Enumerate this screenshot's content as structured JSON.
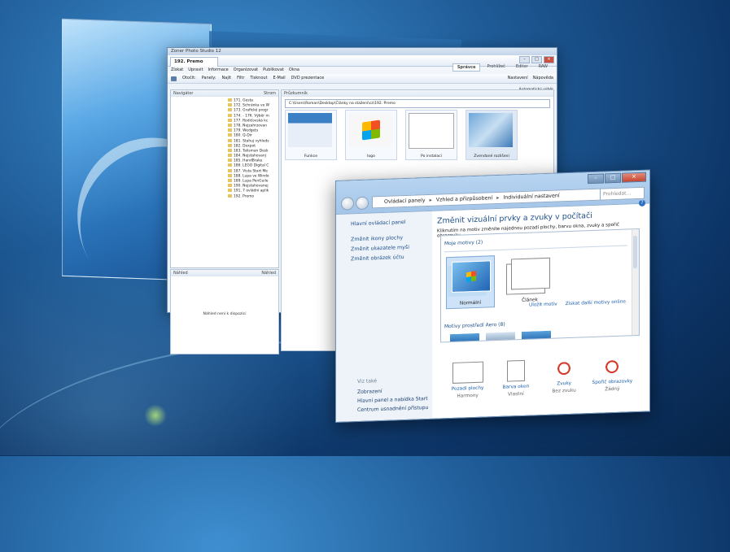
{
  "zoner": {
    "app_title": "Zoner Photo Studio 12",
    "tab": "192. Premo",
    "view_tabs": [
      "Správce",
      "Prohlížeč",
      "Editor",
      "RAW"
    ],
    "active_view": "Správce",
    "menu": [
      "Získat",
      "Upravit",
      "Informace",
      "Organizovat",
      "Publikovat",
      "Okna"
    ],
    "toolbar": [
      "Otočit:",
      "Panely:",
      "Najít",
      "Filtr",
      "Tisknout",
      "E-Mail",
      "DVD prezentace"
    ],
    "toolbar_right": [
      "Nastavení",
      "Nápověda"
    ],
    "toolbar_right2": "Automatický výběr",
    "navigator_title": "Navigátor",
    "navigator_right": "Strom",
    "explorer_title": "Průzkumník",
    "address": "C:\\Users\\Roman\\Desktop\\Články na stažení\\cz\\192. Premo",
    "tree": [
      "171. Gesta",
      "172. Schránka ve W",
      "173. Grafické progr",
      "174. - 176. Výběr m",
      "177. Rodičovská kc",
      "178. Nejzahrzovan",
      "179. Wedgets",
      "180. Q-Dir",
      "181. Stahuj vyhleds",
      "182. Dexpot",
      "183. Talisman Desk",
      "184. Nejstahovanj",
      "185. HandBrake",
      "186. LEGO Digital C",
      "187. Vista Start Me",
      "188. Lupa ve Windo",
      "189. Lupa PenGuile",
      "190. Nejstahovanej",
      "191. 7 ovládní aplik",
      "192. Premo"
    ],
    "preview_title": "Náhled",
    "preview_right": "Náhled",
    "preview_message": "Náhled není k dispozici",
    "thumbnails": [
      "Funkce",
      "logo",
      "Po instalaci",
      "Zvendané rozlišení"
    ]
  },
  "control_panel": {
    "breadcrumb": [
      "Ovládací panely",
      "Vzhled a přizpůsobení",
      "Individuální nastavení"
    ],
    "search_placeholder": "Prohledat...",
    "left_links": [
      "Hlavní ovládací panel",
      "Změnit ikony plochy",
      "Změnit ukazatele myši",
      "Změnit obrázek účtu"
    ],
    "see_also_header": "Viz také",
    "see_also": [
      "Zobrazení",
      "Hlavní panel a nabídka Start",
      "Centrum usnadnění přístupu"
    ],
    "title": "Změnit vizuální prvky a zvuky v počítači",
    "subtitle": "Kliknutím na motiv změníte najednou pozadí plochy, barvu okna, zvuky a spořič obrazovky.",
    "my_themes_group": "Moje motivy (2)",
    "themes": [
      "Normální",
      "Článek"
    ],
    "save_theme": "Uložit motiv",
    "get_more": "Získat další motivy online",
    "aero_group": "Motivy prostředí Aero (8)",
    "bottom": [
      {
        "link": "Pozadí plochy",
        "value": "Harmony"
      },
      {
        "link": "Barva oken",
        "value": "Vlastní"
      },
      {
        "link": "Zvuky",
        "value": "Bez zvuku"
      },
      {
        "link": "Spořič obrazovky",
        "value": "Žádný"
      }
    ]
  },
  "colors": {
    "accent": "#1c4f8c",
    "link": "#1c5fb0",
    "close": "#c7452f"
  }
}
